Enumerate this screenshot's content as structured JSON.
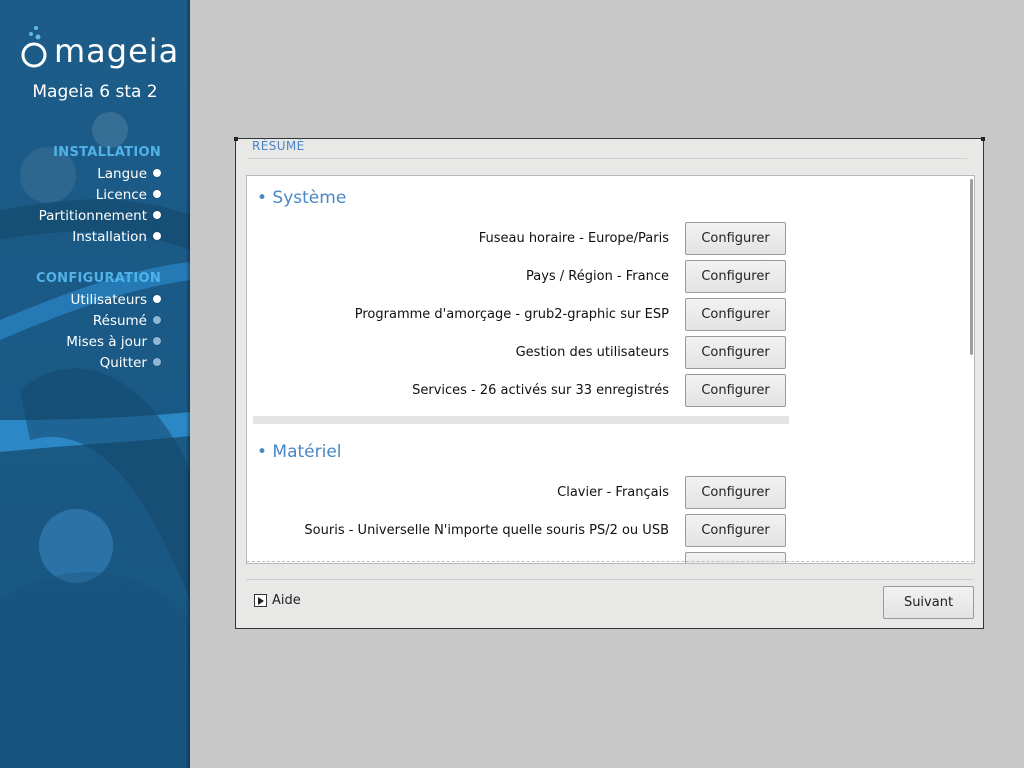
{
  "brand": {
    "logo_text": "mageia",
    "version": "Mageia 6 sta 2"
  },
  "nav": {
    "installation_title": "INSTALLATION",
    "installation_items": [
      "Langue",
      "Licence",
      "Partitionnement",
      "Installation"
    ],
    "configuration_title": "CONFIGURATION",
    "configuration_items": [
      "Utilisateurs",
      "Résumé",
      "Mises à jour",
      "Quitter"
    ]
  },
  "dialog": {
    "title": "RÉSUMÉ",
    "sections": [
      {
        "title": "• Système",
        "rows": [
          {
            "label": "Fuseau horaire - Europe/Paris",
            "button": "Configurer"
          },
          {
            "label": "Pays / Région - France",
            "button": "Configurer"
          },
          {
            "label": "Programme d'amorçage - grub2-graphic sur ESP",
            "button": "Configurer"
          },
          {
            "label": "Gestion des utilisateurs",
            "button": "Configurer"
          },
          {
            "label": "Services - 26 activés sur 33 enregistrés",
            "button": "Configurer"
          }
        ]
      },
      {
        "title": "• Matériel",
        "rows": [
          {
            "label": "Clavier - Français",
            "button": "Configurer"
          },
          {
            "label": "Souris - Universelle N'importe quelle souris PS/2 ou USB",
            "button": "Configurer"
          }
        ]
      }
    ],
    "help_label": "Aide",
    "next_label": "Suivant"
  },
  "colors": {
    "sidebar_bg": "#1b5a86",
    "section_accent": "#4fb3ea",
    "title_accent": "#4a86c8",
    "desktop_bg": "#c8c8c8"
  }
}
